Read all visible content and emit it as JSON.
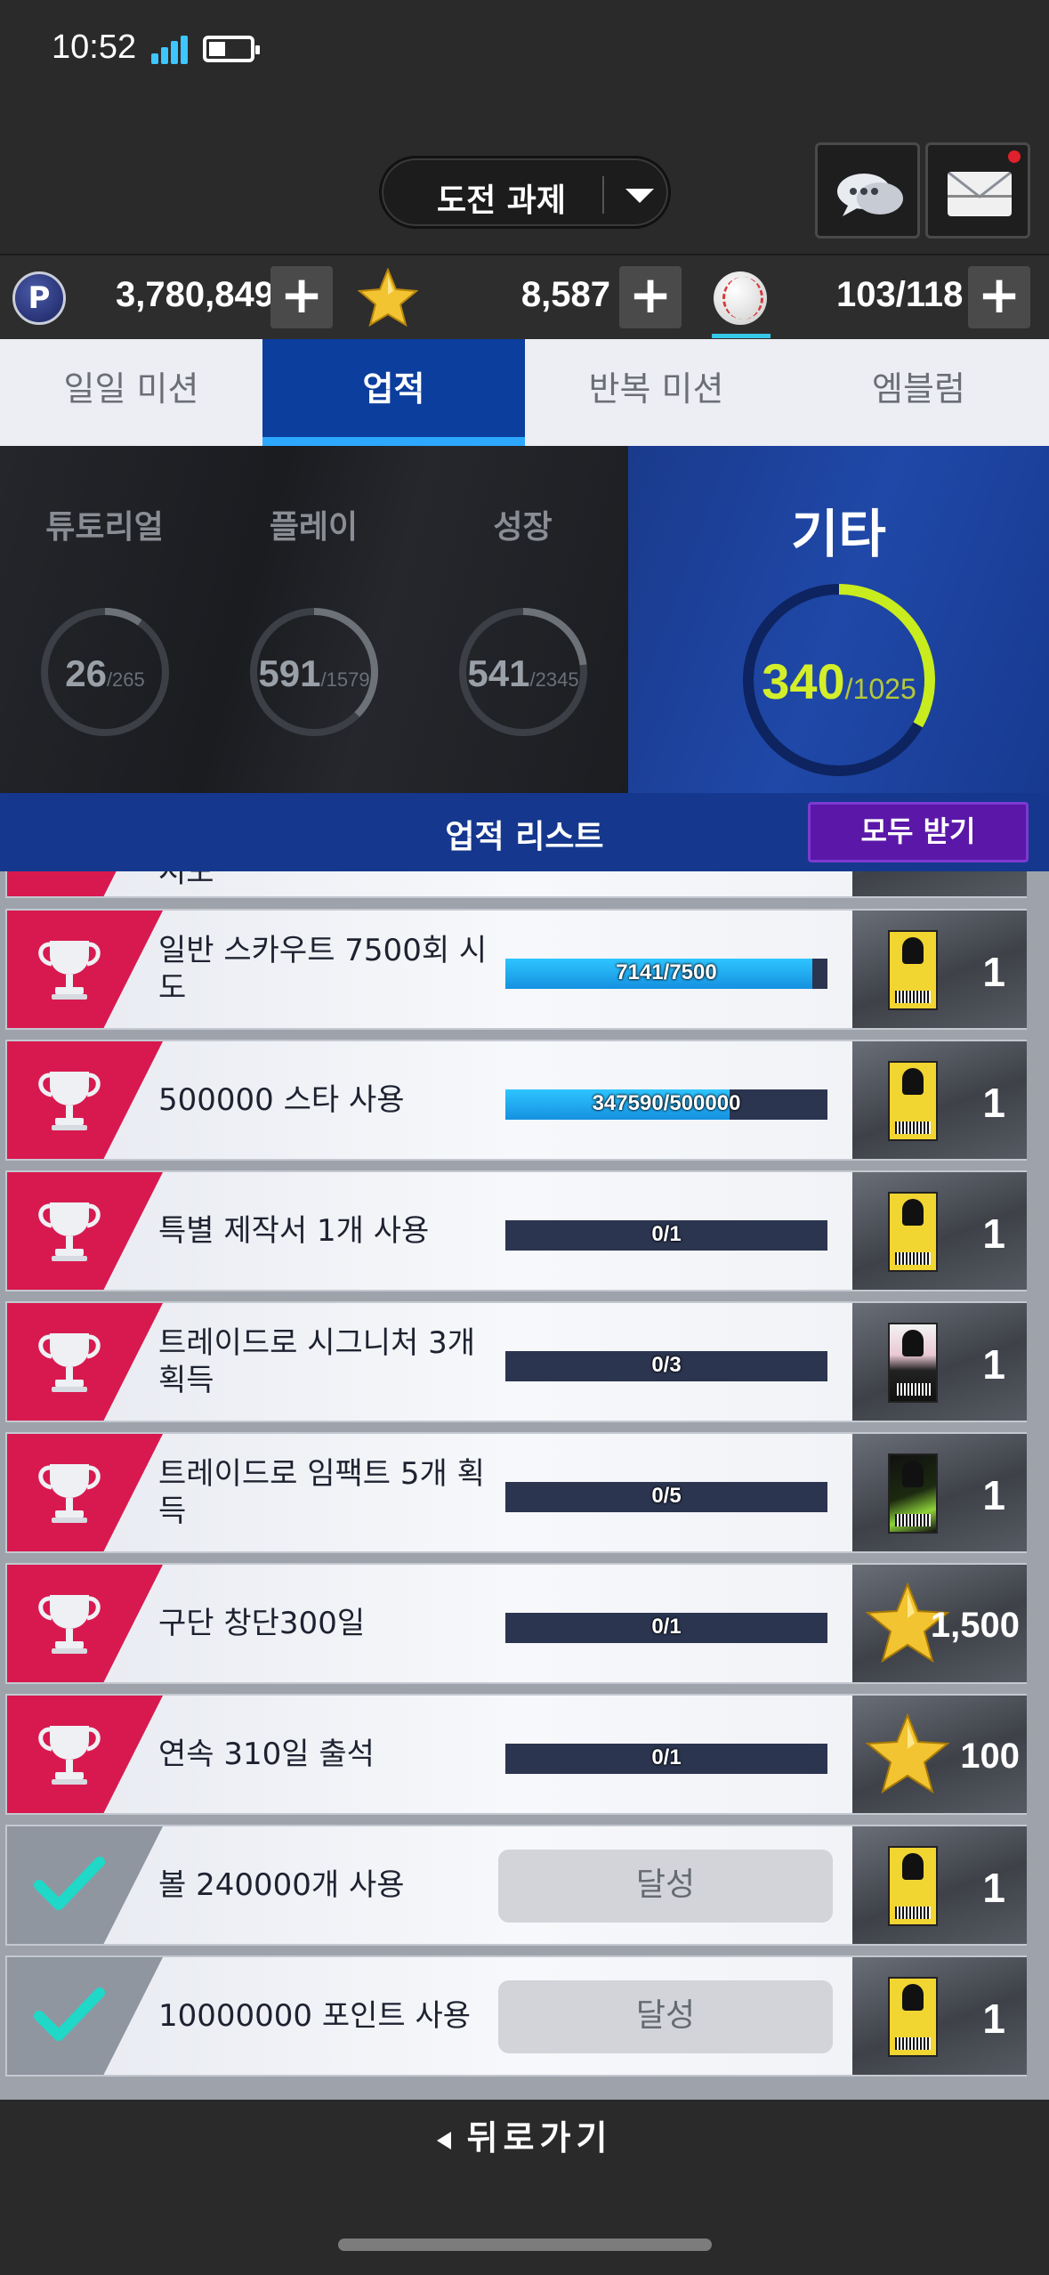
{
  "status_bar": {
    "time": "10:52"
  },
  "header": {
    "title": "도전 과제"
  },
  "currency": {
    "points": "3,780,849",
    "stars": "8,587",
    "balls": "103/118",
    "coin_letter": "P"
  },
  "tabs": [
    {
      "label": "일일 미션",
      "active": false
    },
    {
      "label": "업적",
      "active": true
    },
    {
      "label": "반복 미션",
      "active": false
    },
    {
      "label": "엠블럼",
      "active": false
    }
  ],
  "categories": [
    {
      "name": "튜토리얼",
      "current": "26",
      "total": "/265",
      "progress": 0.098
    },
    {
      "name": "플레이",
      "current": "591",
      "total": "/1579",
      "progress": 0.374
    },
    {
      "name": "성장",
      "current": "541",
      "total": "/2345",
      "progress": 0.231
    },
    {
      "name": "기타",
      "current": "340",
      "total": "/1025",
      "progress": 0.332,
      "selected": true
    }
  ],
  "list_header": {
    "title": "업적 리스트",
    "claim_all": "모두 받기"
  },
  "rows": [
    {
      "label": "일반 스카우트 7500회 시도",
      "progress_text": "7141/7500",
      "progress": 0.952,
      "reward_type": "ticket",
      "reward_count": "1",
      "done": false
    },
    {
      "label": "500000 스타 사용",
      "progress_text": "347590/500000",
      "progress": 0.695,
      "reward_type": "ticket",
      "reward_count": "1",
      "done": false
    },
    {
      "label": "특별 제작서 1개 사용",
      "progress_text": "0/1",
      "progress": 0,
      "reward_type": "ticket",
      "reward_count": "1",
      "done": false
    },
    {
      "label": "트레이드로 시그니처 3개 획득",
      "progress_text": "0/3",
      "progress": 0,
      "reward_type": "signature-ticket",
      "reward_count": "1",
      "done": false
    },
    {
      "label": "트레이드로 임팩트 5개 획득",
      "progress_text": "0/5",
      "progress": 0,
      "reward_type": "impact-ticket",
      "reward_count": "1",
      "done": false
    },
    {
      "label": "구단 창단300일",
      "progress_text": "0/1",
      "progress": 0,
      "reward_type": "star",
      "reward_count": "1,500",
      "done": false
    },
    {
      "label": "연속 310일 출석",
      "progress_text": "0/1",
      "progress": 0,
      "reward_type": "star",
      "reward_count": "100",
      "done": false
    },
    {
      "label": "볼 240000개 사용",
      "status_text": "달성",
      "reward_type": "ticket",
      "reward_count": "1",
      "done": true
    },
    {
      "label": "10000000 포인트 사용",
      "status_text": "달성",
      "reward_type": "ticket",
      "reward_count": "1",
      "done": true
    }
  ],
  "partial_row": {
    "label": "시도"
  },
  "footer": {
    "back_label": "뒤로가기"
  },
  "colors": {
    "accent_blue": "#0c3e9e",
    "trophy_red": "#d8194f",
    "ring_lime": "#c8ec1e",
    "claim_purple": "#5a17a8"
  }
}
